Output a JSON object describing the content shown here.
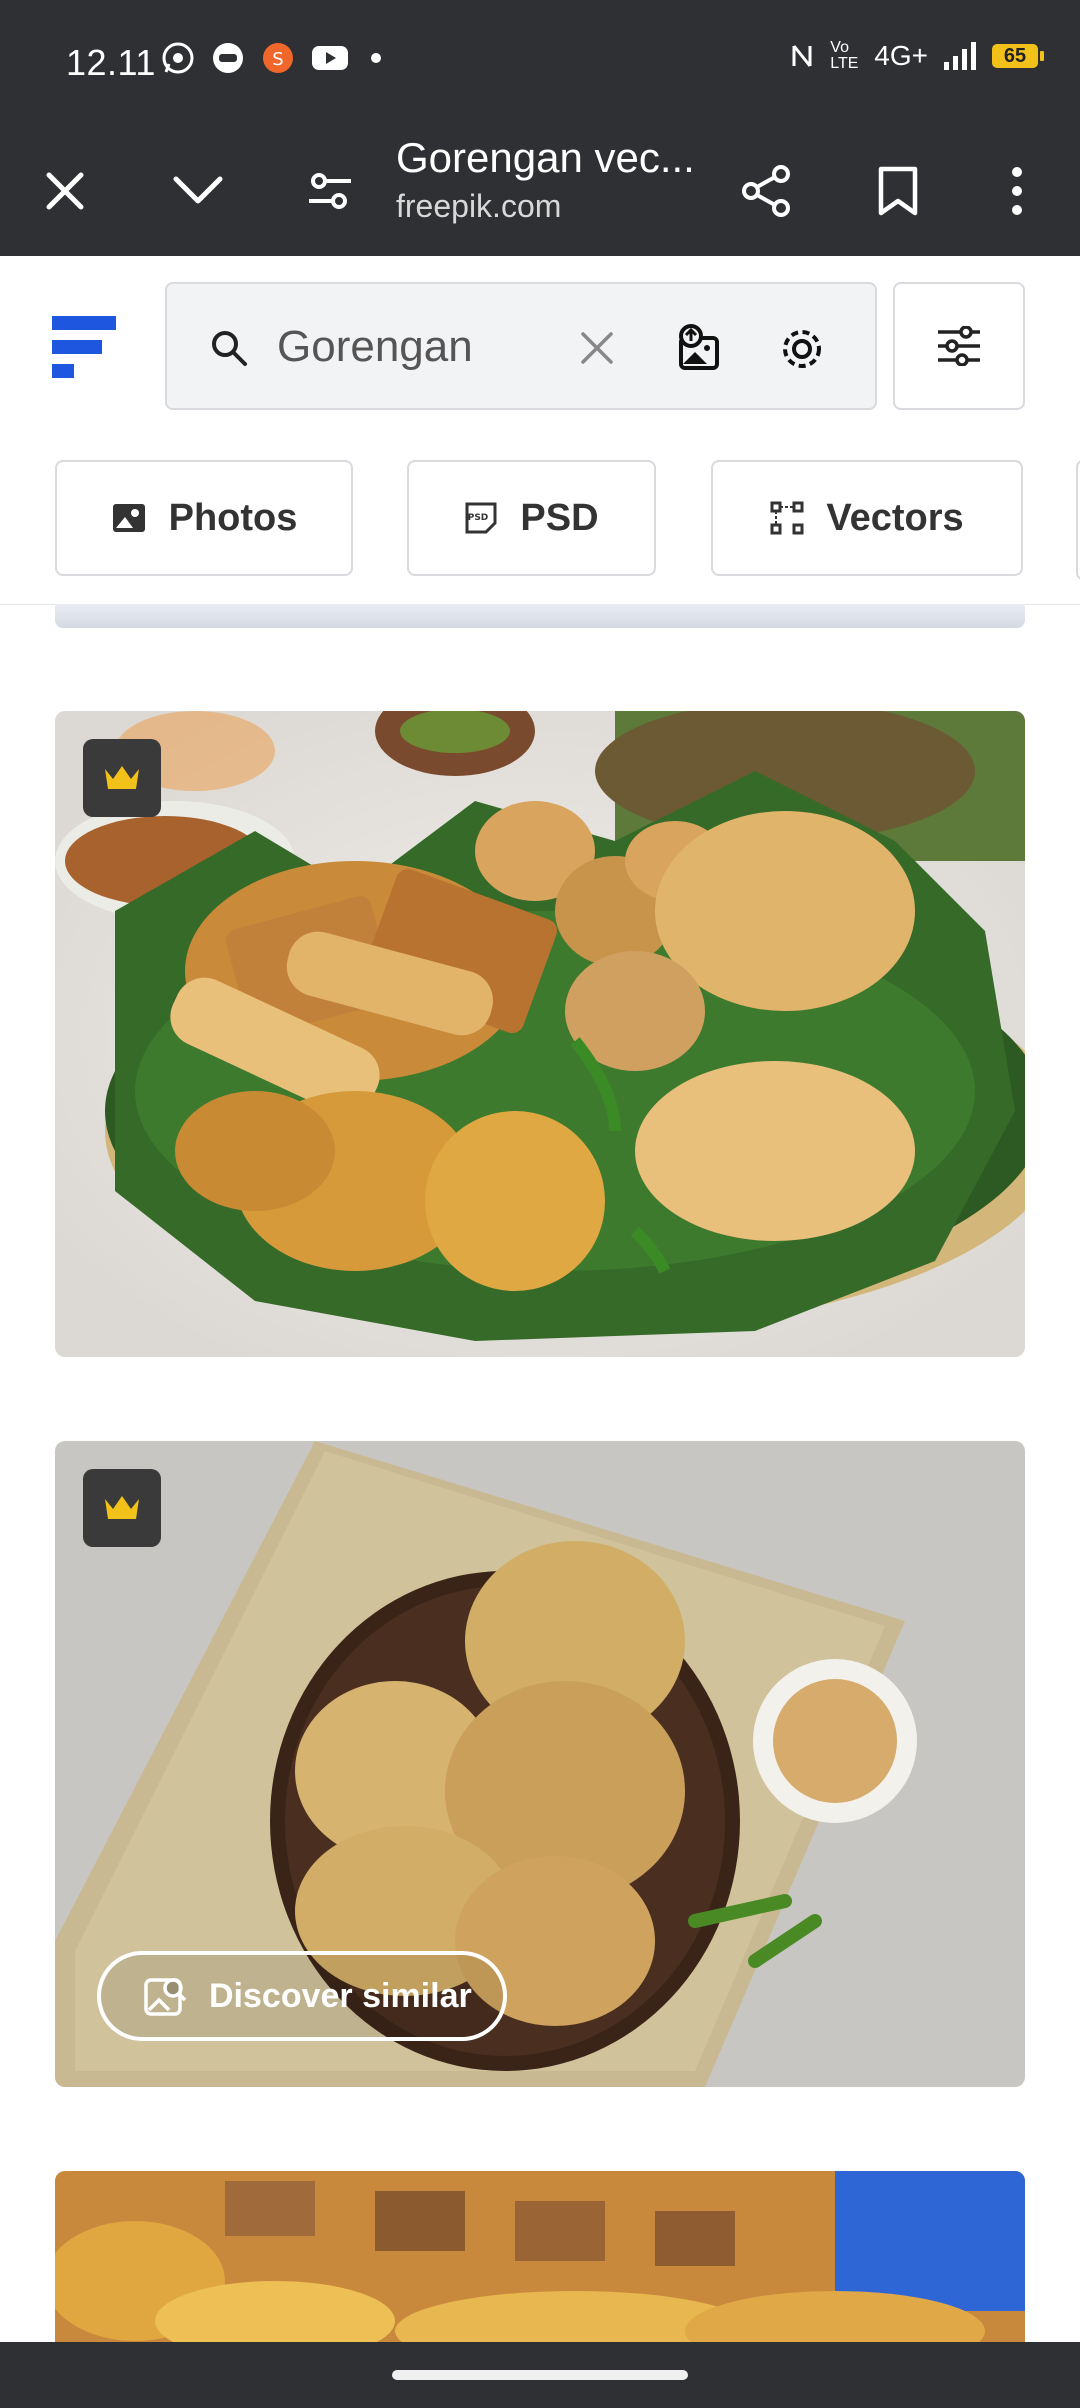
{
  "status_bar": {
    "time": "12.11",
    "network": "4G+",
    "volte": "Vo LTE",
    "battery": "65",
    "app_icons": [
      "whatsapp-icon",
      "messenger-icon",
      "shopee-icon",
      "youtube-icon",
      "dot-icon"
    ]
  },
  "browser": {
    "page_title": "Gorengan vec...",
    "domain": "freepik.com",
    "icons": [
      "close-icon",
      "chevron-down-icon",
      "tune-icon",
      "share-icon",
      "bookmark-icon",
      "more-vert-icon"
    ]
  },
  "search": {
    "query": "Gorengan"
  },
  "filters": [
    {
      "label": "Photos",
      "icon": "image-icon"
    },
    {
      "label": "PSD",
      "icon": "psd-icon"
    },
    {
      "label": "Vectors",
      "icon": "vector-icon"
    }
  ],
  "results": [
    {
      "premium": true,
      "discover_label": ""
    },
    {
      "premium": true,
      "discover_label": "Discover similar"
    },
    {
      "premium": false,
      "discover_label": ""
    }
  ],
  "colors": {
    "toolbar_bg": "#2e3033",
    "brand_blue": "#1f56e0",
    "premium_gold": "#f2c21a"
  }
}
